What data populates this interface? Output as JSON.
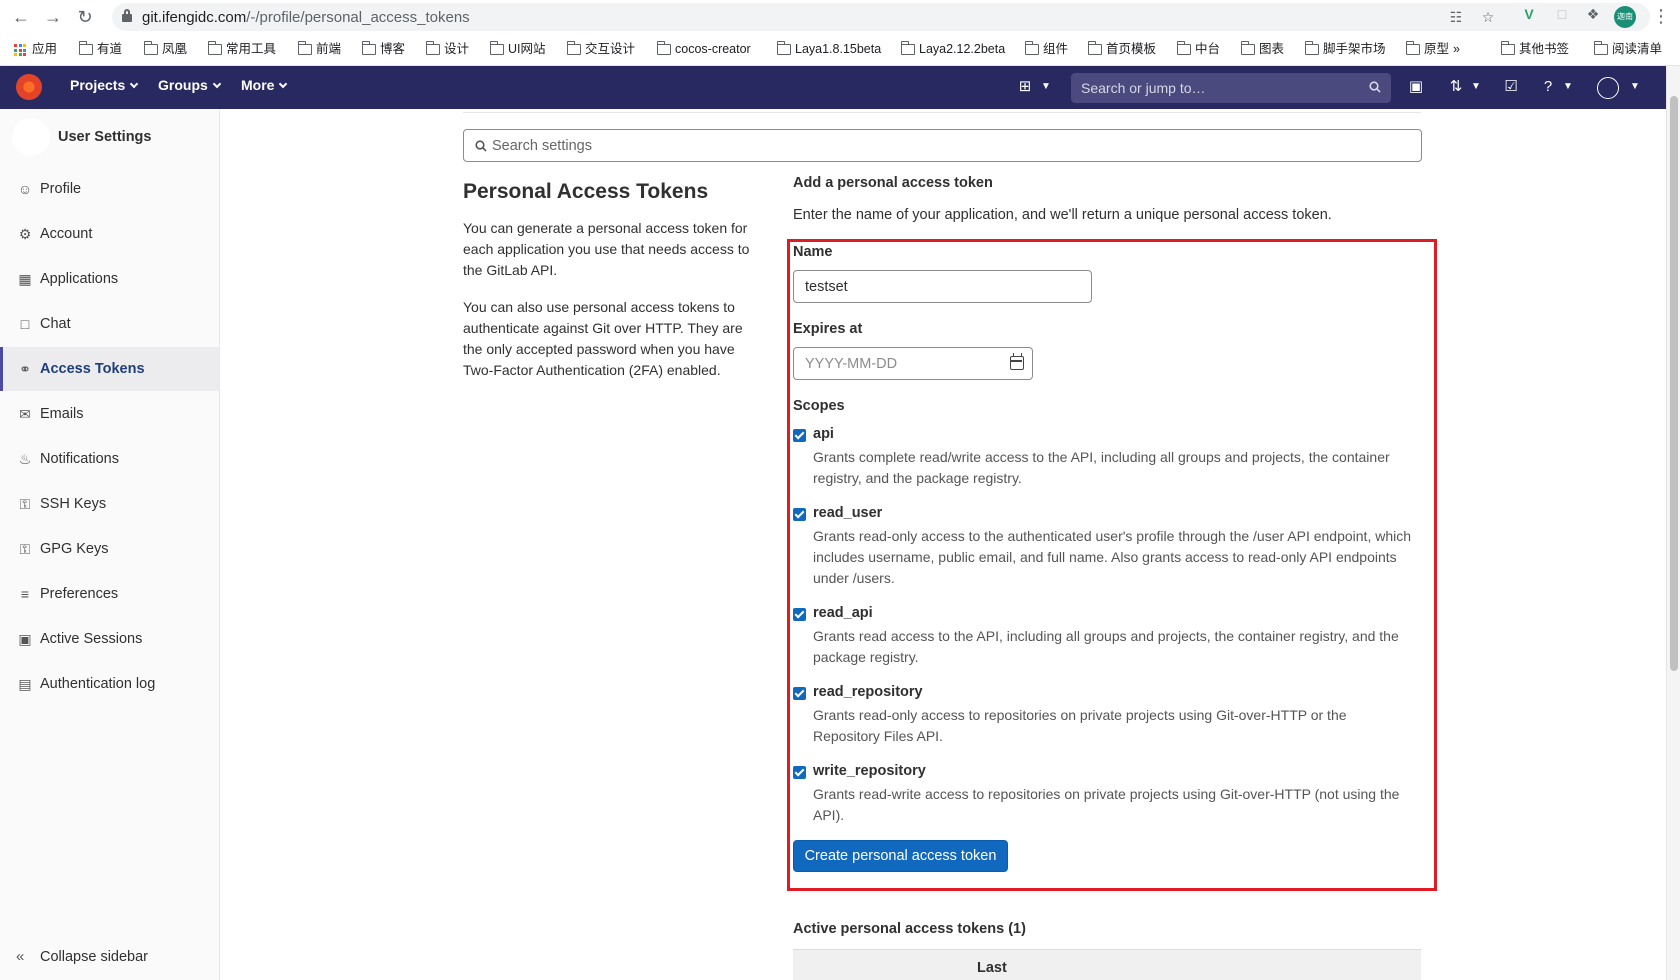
{
  "browser": {
    "url_host": "git.ifengidc.com",
    "url_path": "/-/profile/personal_access_tokens",
    "profile_badge": "迦南",
    "bookmarks": [
      "应用",
      "有道",
      "凤凰",
      "常用工具",
      "前端",
      "博客",
      "设计",
      "UI网站",
      "交互设计",
      "cocos-creator",
      "Laya1.8.15beta",
      "Laya2.12.2beta",
      "组件",
      "首页模板",
      "中台",
      "图表",
      "脚手架市场",
      "原型",
      "»",
      "其他书签",
      "阅读清单"
    ]
  },
  "header": {
    "nav": [
      "Projects",
      "Groups",
      "More"
    ],
    "search_placeholder": "Search or jump to…"
  },
  "sidebar": {
    "title": "User Settings",
    "items": [
      {
        "label": "Profile",
        "icon": "profile-icon"
      },
      {
        "label": "Account",
        "icon": "account-icon"
      },
      {
        "label": "Applications",
        "icon": "applications-icon"
      },
      {
        "label": "Chat",
        "icon": "chat-icon"
      },
      {
        "label": "Access Tokens",
        "icon": "token-icon",
        "active": true
      },
      {
        "label": "Emails",
        "icon": "mail-icon"
      },
      {
        "label": "Notifications",
        "icon": "bell-icon"
      },
      {
        "label": "SSH Keys",
        "icon": "key-icon"
      },
      {
        "label": "GPG Keys",
        "icon": "key-icon"
      },
      {
        "label": "Preferences",
        "icon": "preferences-icon"
      },
      {
        "label": "Active Sessions",
        "icon": "monitor-icon"
      },
      {
        "label": "Authentication log",
        "icon": "log-icon"
      }
    ],
    "collapse_label": "Collapse sidebar"
  },
  "main": {
    "search_placeholder": "Search settings",
    "title": "Personal Access Tokens",
    "desc1": "You can generate a personal access token for each application you use that needs access to the GitLab API.",
    "desc2": "You can also use personal access tokens to authenticate against Git over HTTP. They are the only accepted password when you have Two-Factor Authentication (2FA) enabled.",
    "add_title": "Add a personal access token",
    "add_intro": "Enter the name of your application, and we'll return a unique personal access token.",
    "name_label": "Name",
    "name_value": "testset",
    "expires_label": "Expires at",
    "expires_placeholder": "YYYY-MM-DD",
    "scopes_label": "Scopes",
    "scopes": [
      {
        "name": "api",
        "checked": true,
        "desc": "Grants complete read/write access to the API, including all groups and projects, the container registry, and the package registry."
      },
      {
        "name": "read_user",
        "checked": true,
        "desc": "Grants read-only access to the authenticated user's profile through the /user API endpoint, which includes username, public email, and full name. Also grants access to read-only API endpoints under /users."
      },
      {
        "name": "read_api",
        "checked": true,
        "desc": "Grants read access to the API, including all groups and projects, the container registry, and the package registry."
      },
      {
        "name": "read_repository",
        "checked": true,
        "desc": "Grants read-only access to repositories on private projects using Git-over-HTTP or the Repository Files API."
      },
      {
        "name": "write_repository",
        "checked": true,
        "desc": "Grants read-write access to repositories on private projects using Git-over-HTTP (not using the API)."
      }
    ],
    "create_button": "Create personal access token",
    "active_title": "Active personal access tokens (1)",
    "table_header_last": "Last"
  },
  "colors": {
    "header_bg": "#292961",
    "primary_button": "#1068bf",
    "highlight_box": "#e01b24"
  }
}
